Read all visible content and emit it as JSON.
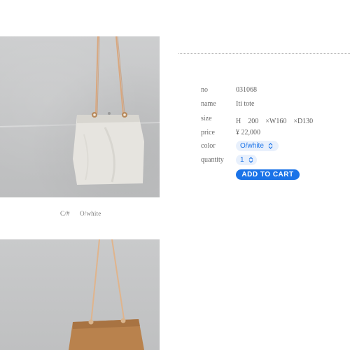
{
  "product": {
    "fields": {
      "no_label": "no",
      "no_value": "031068",
      "name_label": "name",
      "name_value": "Iti tote",
      "size_label": "size",
      "size_h": "H　200",
      "size_w": "×W160",
      "size_d": "×D130",
      "price_label": "price",
      "price_value": "¥ 22,000",
      "color_label": "color",
      "color_selected": "O/white",
      "quantity_label": "quantity",
      "quantity_selected": "1"
    },
    "add_to_cart_label": "ADD TO CART",
    "caption": {
      "code": "C/#",
      "color": "O/white"
    }
  },
  "colors": {
    "accent": "#1a73e8",
    "select_bg": "#e8f0fc",
    "bag_white": "#e6e4df",
    "bag_brown": "#b9824d",
    "strap": "#d9a77e"
  },
  "icons": [
    "chevron-updown-icon"
  ]
}
